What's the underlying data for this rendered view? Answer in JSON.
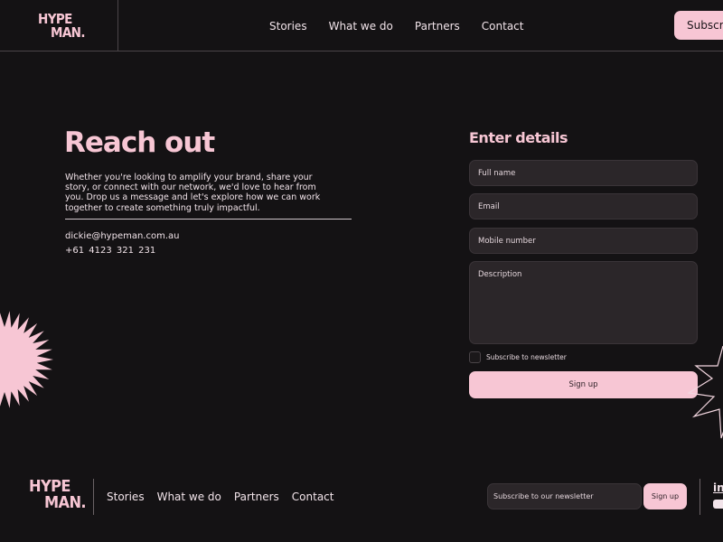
{
  "brand": {
    "logo_line1": "HYPE",
    "logo_line2": "MAN.",
    "accent_color": "#f7c6d4",
    "background_color": "#141214"
  },
  "header": {
    "nav": [
      {
        "label": "Stories"
      },
      {
        "label": "What we do"
      },
      {
        "label": "Partners"
      },
      {
        "label": "Contact"
      }
    ],
    "subscribe_label": "Subscribe"
  },
  "contact": {
    "title": "Reach out",
    "intro": "Whether you're looking to amplify your brand, share your story, or connect with our network, we'd love to hear from you. Drop us a message and let's explore how we can work together to create something truly impactful.",
    "email": "dickie@hypeman.com.au",
    "phone": "+61  4123 321 231"
  },
  "form": {
    "title": "Enter details",
    "full_name_placeholder": "Full name",
    "email_placeholder": "Email",
    "mobile_placeholder": "Mobile number",
    "description_placeholder": "Description",
    "newsletter_checkbox_label": "Subscribe to newsletter",
    "newsletter_checked": false,
    "submit_label": "Sign up"
  },
  "footer": {
    "nav": [
      {
        "label": "Stories"
      },
      {
        "label": "What we do"
      },
      {
        "label": "Partners"
      },
      {
        "label": "Contact"
      }
    ],
    "newsletter_placeholder": "Subscribe to our newsletter",
    "newsletter_button_label": "Sign up",
    "social_icons": [
      "linkedin-icon",
      "youtube-icon"
    ]
  }
}
